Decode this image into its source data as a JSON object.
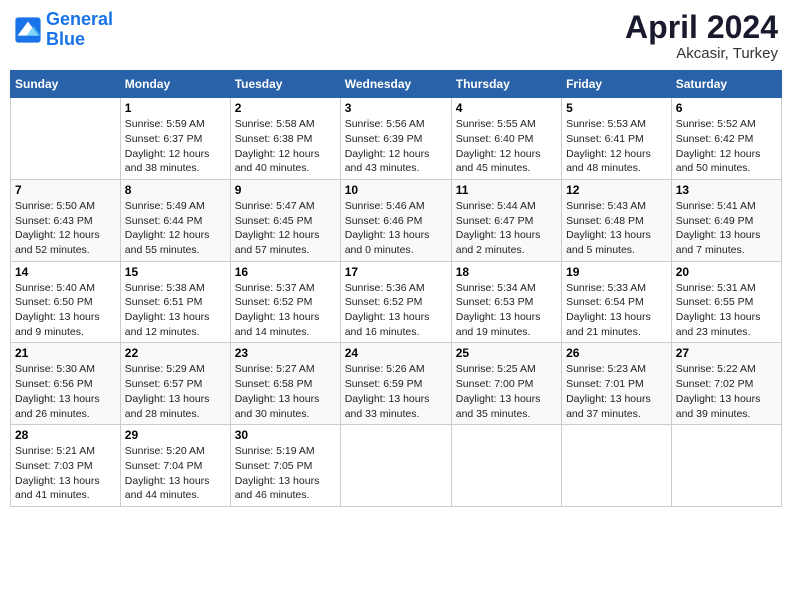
{
  "header": {
    "logo_line1": "General",
    "logo_line2": "Blue",
    "month_year": "April 2024",
    "location": "Akcasir, Turkey"
  },
  "days_of_week": [
    "Sunday",
    "Monday",
    "Tuesday",
    "Wednesday",
    "Thursday",
    "Friday",
    "Saturday"
  ],
  "weeks": [
    [
      {
        "day": "",
        "sunrise": "",
        "sunset": "",
        "daylight": ""
      },
      {
        "day": "1",
        "sunrise": "Sunrise: 5:59 AM",
        "sunset": "Sunset: 6:37 PM",
        "daylight": "Daylight: 12 hours and 38 minutes."
      },
      {
        "day": "2",
        "sunrise": "Sunrise: 5:58 AM",
        "sunset": "Sunset: 6:38 PM",
        "daylight": "Daylight: 12 hours and 40 minutes."
      },
      {
        "day": "3",
        "sunrise": "Sunrise: 5:56 AM",
        "sunset": "Sunset: 6:39 PM",
        "daylight": "Daylight: 12 hours and 43 minutes."
      },
      {
        "day": "4",
        "sunrise": "Sunrise: 5:55 AM",
        "sunset": "Sunset: 6:40 PM",
        "daylight": "Daylight: 12 hours and 45 minutes."
      },
      {
        "day": "5",
        "sunrise": "Sunrise: 5:53 AM",
        "sunset": "Sunset: 6:41 PM",
        "daylight": "Daylight: 12 hours and 48 minutes."
      },
      {
        "day": "6",
        "sunrise": "Sunrise: 5:52 AM",
        "sunset": "Sunset: 6:42 PM",
        "daylight": "Daylight: 12 hours and 50 minutes."
      }
    ],
    [
      {
        "day": "7",
        "sunrise": "Sunrise: 5:50 AM",
        "sunset": "Sunset: 6:43 PM",
        "daylight": "Daylight: 12 hours and 52 minutes."
      },
      {
        "day": "8",
        "sunrise": "Sunrise: 5:49 AM",
        "sunset": "Sunset: 6:44 PM",
        "daylight": "Daylight: 12 hours and 55 minutes."
      },
      {
        "day": "9",
        "sunrise": "Sunrise: 5:47 AM",
        "sunset": "Sunset: 6:45 PM",
        "daylight": "Daylight: 12 hours and 57 minutes."
      },
      {
        "day": "10",
        "sunrise": "Sunrise: 5:46 AM",
        "sunset": "Sunset: 6:46 PM",
        "daylight": "Daylight: 13 hours and 0 minutes."
      },
      {
        "day": "11",
        "sunrise": "Sunrise: 5:44 AM",
        "sunset": "Sunset: 6:47 PM",
        "daylight": "Daylight: 13 hours and 2 minutes."
      },
      {
        "day": "12",
        "sunrise": "Sunrise: 5:43 AM",
        "sunset": "Sunset: 6:48 PM",
        "daylight": "Daylight: 13 hours and 5 minutes."
      },
      {
        "day": "13",
        "sunrise": "Sunrise: 5:41 AM",
        "sunset": "Sunset: 6:49 PM",
        "daylight": "Daylight: 13 hours and 7 minutes."
      }
    ],
    [
      {
        "day": "14",
        "sunrise": "Sunrise: 5:40 AM",
        "sunset": "Sunset: 6:50 PM",
        "daylight": "Daylight: 13 hours and 9 minutes."
      },
      {
        "day": "15",
        "sunrise": "Sunrise: 5:38 AM",
        "sunset": "Sunset: 6:51 PM",
        "daylight": "Daylight: 13 hours and 12 minutes."
      },
      {
        "day": "16",
        "sunrise": "Sunrise: 5:37 AM",
        "sunset": "Sunset: 6:52 PM",
        "daylight": "Daylight: 13 hours and 14 minutes."
      },
      {
        "day": "17",
        "sunrise": "Sunrise: 5:36 AM",
        "sunset": "Sunset: 6:52 PM",
        "daylight": "Daylight: 13 hours and 16 minutes."
      },
      {
        "day": "18",
        "sunrise": "Sunrise: 5:34 AM",
        "sunset": "Sunset: 6:53 PM",
        "daylight": "Daylight: 13 hours and 19 minutes."
      },
      {
        "day": "19",
        "sunrise": "Sunrise: 5:33 AM",
        "sunset": "Sunset: 6:54 PM",
        "daylight": "Daylight: 13 hours and 21 minutes."
      },
      {
        "day": "20",
        "sunrise": "Sunrise: 5:31 AM",
        "sunset": "Sunset: 6:55 PM",
        "daylight": "Daylight: 13 hours and 23 minutes."
      }
    ],
    [
      {
        "day": "21",
        "sunrise": "Sunrise: 5:30 AM",
        "sunset": "Sunset: 6:56 PM",
        "daylight": "Daylight: 13 hours and 26 minutes."
      },
      {
        "day": "22",
        "sunrise": "Sunrise: 5:29 AM",
        "sunset": "Sunset: 6:57 PM",
        "daylight": "Daylight: 13 hours and 28 minutes."
      },
      {
        "day": "23",
        "sunrise": "Sunrise: 5:27 AM",
        "sunset": "Sunset: 6:58 PM",
        "daylight": "Daylight: 13 hours and 30 minutes."
      },
      {
        "day": "24",
        "sunrise": "Sunrise: 5:26 AM",
        "sunset": "Sunset: 6:59 PM",
        "daylight": "Daylight: 13 hours and 33 minutes."
      },
      {
        "day": "25",
        "sunrise": "Sunrise: 5:25 AM",
        "sunset": "Sunset: 7:00 PM",
        "daylight": "Daylight: 13 hours and 35 minutes."
      },
      {
        "day": "26",
        "sunrise": "Sunrise: 5:23 AM",
        "sunset": "Sunset: 7:01 PM",
        "daylight": "Daylight: 13 hours and 37 minutes."
      },
      {
        "day": "27",
        "sunrise": "Sunrise: 5:22 AM",
        "sunset": "Sunset: 7:02 PM",
        "daylight": "Daylight: 13 hours and 39 minutes."
      }
    ],
    [
      {
        "day": "28",
        "sunrise": "Sunrise: 5:21 AM",
        "sunset": "Sunset: 7:03 PM",
        "daylight": "Daylight: 13 hours and 41 minutes."
      },
      {
        "day": "29",
        "sunrise": "Sunrise: 5:20 AM",
        "sunset": "Sunset: 7:04 PM",
        "daylight": "Daylight: 13 hours and 44 minutes."
      },
      {
        "day": "30",
        "sunrise": "Sunrise: 5:19 AM",
        "sunset": "Sunset: 7:05 PM",
        "daylight": "Daylight: 13 hours and 46 minutes."
      },
      {
        "day": "",
        "sunrise": "",
        "sunset": "",
        "daylight": ""
      },
      {
        "day": "",
        "sunrise": "",
        "sunset": "",
        "daylight": ""
      },
      {
        "day": "",
        "sunrise": "",
        "sunset": "",
        "daylight": ""
      },
      {
        "day": "",
        "sunrise": "",
        "sunset": "",
        "daylight": ""
      }
    ]
  ]
}
